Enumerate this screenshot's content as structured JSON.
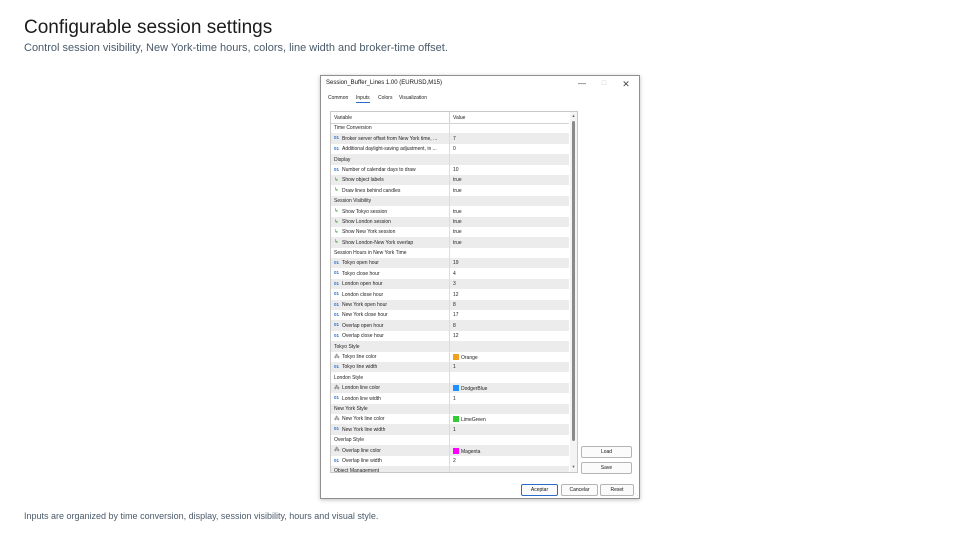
{
  "page": {
    "title": "Configurable session settings",
    "subtitle": "Control session visibility, New York-time hours, colors, line width and broker-time offset.",
    "footer": "Inputs are organized by time conversion, display, session visibility, hours and visual style."
  },
  "dialog": {
    "title": "Session_Buffer_Lines 1.00 (EURUSD,M15)",
    "tabs": [
      "Common",
      "Inputs",
      "Colors",
      "Visualization"
    ],
    "active_tab": "Inputs",
    "columns": {
      "variable": "Variable",
      "value": "Value"
    },
    "rows": [
      {
        "type": "group",
        "name": "Time Conversion",
        "value": ""
      },
      {
        "type": "num",
        "name": "Broker server offset from New York time, ...",
        "value": "7"
      },
      {
        "type": "num",
        "name": "Additional daylight-saving adjustment, in ...",
        "value": "0"
      },
      {
        "type": "group",
        "name": "Display",
        "value": ""
      },
      {
        "type": "num",
        "name": "Number of calendar days to draw",
        "value": "10"
      },
      {
        "type": "bool",
        "name": "Show object labels",
        "value": "true"
      },
      {
        "type": "bool",
        "name": "Draw lines behind candles",
        "value": "true"
      },
      {
        "type": "group",
        "name": "Session Visibility",
        "value": ""
      },
      {
        "type": "bool",
        "name": "Show Tokyo session",
        "value": "true"
      },
      {
        "type": "bool",
        "name": "Show London session",
        "value": "true"
      },
      {
        "type": "bool",
        "name": "Show New York session",
        "value": "true"
      },
      {
        "type": "bool",
        "name": "Show London-New York overlap",
        "value": "true"
      },
      {
        "type": "group",
        "name": "Session Hours in New York Time",
        "value": ""
      },
      {
        "type": "num",
        "name": "Tokyo open hour",
        "value": "19"
      },
      {
        "type": "num",
        "name": "Tokyo close hour",
        "value": "4"
      },
      {
        "type": "num",
        "name": "London open hour",
        "value": "3"
      },
      {
        "type": "num",
        "name": "London close hour",
        "value": "12"
      },
      {
        "type": "num",
        "name": "New York open hour",
        "value": "8"
      },
      {
        "type": "num",
        "name": "New York close hour",
        "value": "17"
      },
      {
        "type": "num",
        "name": "Overlap open hour",
        "value": "8"
      },
      {
        "type": "num",
        "name": "Overlap close hour",
        "value": "12"
      },
      {
        "type": "group",
        "name": "Tokyo Style",
        "value": ""
      },
      {
        "type": "color",
        "name": "Tokyo line color",
        "value": "Orange",
        "swatch": "#f0a020"
      },
      {
        "type": "num",
        "name": "Tokyo line width",
        "value": "1"
      },
      {
        "type": "group",
        "name": "London Style",
        "value": ""
      },
      {
        "type": "color",
        "name": "London line color",
        "value": "DodgerBlue",
        "swatch": "#1e90ff"
      },
      {
        "type": "num",
        "name": "London line width",
        "value": "1"
      },
      {
        "type": "group",
        "name": "New York Style",
        "value": ""
      },
      {
        "type": "color",
        "name": "New York line color",
        "value": "LimeGreen",
        "swatch": "#32cd32"
      },
      {
        "type": "num",
        "name": "New York line width",
        "value": "1"
      },
      {
        "type": "group",
        "name": "Overlap Style",
        "value": ""
      },
      {
        "type": "color",
        "name": "Overlap line color",
        "value": "Magenta",
        "swatch": "#ff00ff"
      },
      {
        "type": "num",
        "name": "Overlap line width",
        "value": "2"
      },
      {
        "type": "group",
        "name": "Object Management",
        "value": ""
      }
    ],
    "icons": {
      "num": "01",
      "bool": "↳",
      "color": "⁂"
    },
    "side_buttons": {
      "load": "Load",
      "save": "Save"
    },
    "footer_buttons": {
      "ok": "Aceptar",
      "cancel": "Cancelar",
      "reset": "Reset"
    },
    "accent": "#2b6ac9"
  }
}
